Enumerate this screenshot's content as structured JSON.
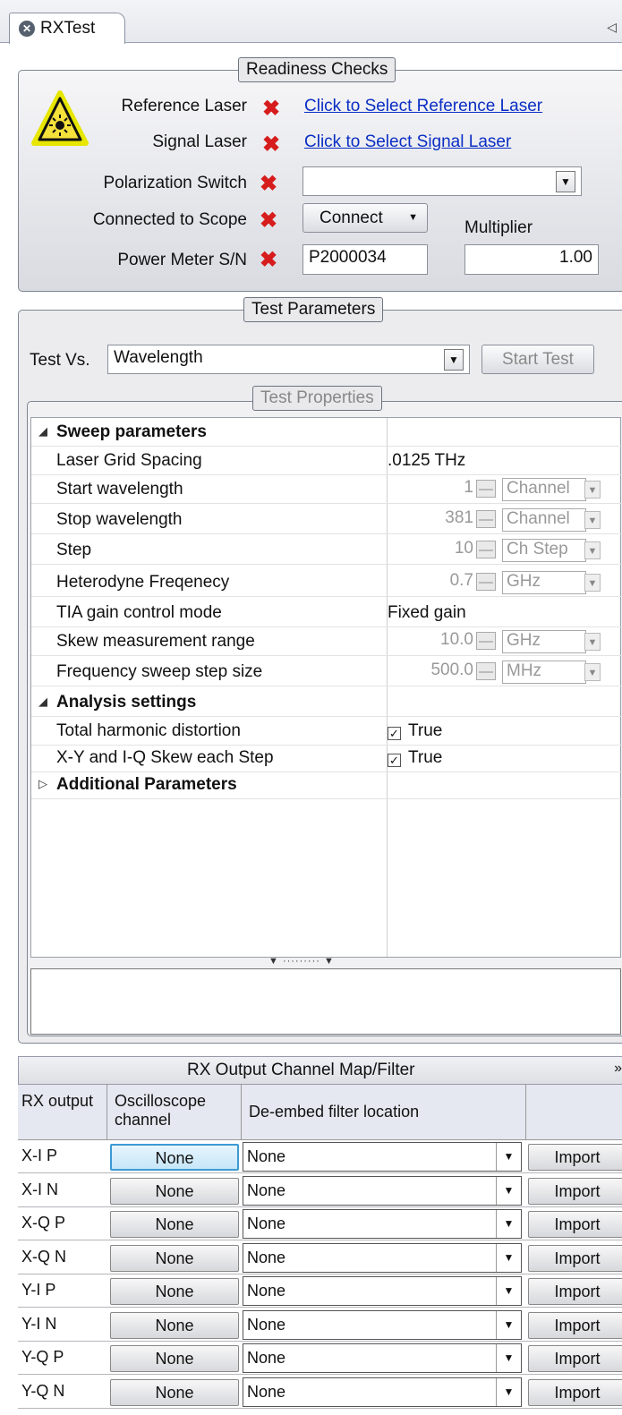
{
  "tab": {
    "title": "RXTest"
  },
  "readiness": {
    "legend": "Readiness Checks",
    "reference_laser_label": "Reference Laser",
    "reference_laser_link": "Click to Select Reference Laser",
    "signal_laser_label": "Signal Laser",
    "signal_laser_link": "Click to Select Signal Laser",
    "polarization_label": "Polarization Switch",
    "polarization_value": "",
    "scope_label": "Connected to Scope",
    "connect_label": "Connect",
    "multiplier_label": "Multiplier",
    "power_meter_label": "Power Meter S/N",
    "power_meter_value": "P2000034",
    "multiplier_value": "1.00"
  },
  "test_params": {
    "legend": "Test Parameters",
    "test_vs_label": "Test Vs.",
    "test_vs_value": "Wavelength",
    "start_test_label": "Start Test",
    "props_legend": "Test Properties"
  },
  "grid": {
    "sweep_cat": "Sweep parameters",
    "laser_grid_label": "Laser Grid Spacing",
    "laser_grid_value": ".0125 THz",
    "start_wl_label": "Start wavelength",
    "start_wl_value": "1",
    "start_wl_unit": "Channel",
    "stop_wl_label": "Stop wavelength",
    "stop_wl_value": "381",
    "stop_wl_unit": "Channel",
    "step_label": "Step",
    "step_value": "10",
    "step_unit": "Ch Step",
    "het_label": "Heterodyne Freqenecy",
    "het_value": "0.7",
    "het_unit": "GHz",
    "tia_label": "TIA gain control mode",
    "tia_value": "Fixed gain",
    "skew_label": "Skew measurement range",
    "skew_value": "10.0",
    "skew_unit": "GHz",
    "fsweep_label": "Frequency sweep step size",
    "fsweep_value": "500.0",
    "fsweep_unit": "MHz",
    "analysis_cat": "Analysis settings",
    "thd_label": "Total harmonic distortion",
    "thd_value": "True",
    "xyiq_label": "X-Y and I-Q Skew each Step",
    "xyiq_value": "True",
    "additional_cat": "Additional Parameters"
  },
  "channel_map": {
    "title": "RX Output Channel Map/Filter",
    "col_rx": "RX output",
    "col_osc": "Oscilloscope channel",
    "col_filter": "De-embed filter location",
    "rows": [
      {
        "rx": "X-I P",
        "osc": "None",
        "filter": "None",
        "import": "Import"
      },
      {
        "rx": "X-I N",
        "osc": "None",
        "filter": "None",
        "import": "Import"
      },
      {
        "rx": "X-Q P",
        "osc": "None",
        "filter": "None",
        "import": "Import"
      },
      {
        "rx": "X-Q N",
        "osc": "None",
        "filter": "None",
        "import": "Import"
      },
      {
        "rx": "Y-I P",
        "osc": "None",
        "filter": "None",
        "import": "Import"
      },
      {
        "rx": "Y-I N",
        "osc": "None",
        "filter": "None",
        "import": "Import"
      },
      {
        "rx": "Y-Q P",
        "osc": "None",
        "filter": "None",
        "import": "Import"
      },
      {
        "rx": "Y-Q N",
        "osc": "None",
        "filter": "None",
        "import": "Import"
      }
    ]
  }
}
